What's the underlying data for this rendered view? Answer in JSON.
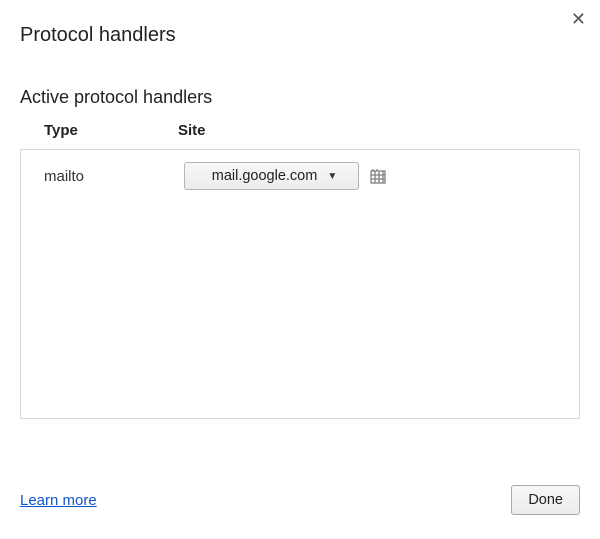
{
  "dialog": {
    "title": "Protocol handlers",
    "section_title": "Active protocol handlers"
  },
  "columns": {
    "type": "Type",
    "site": "Site"
  },
  "handlers": [
    {
      "type": "mailto",
      "site": "mail.google.com"
    }
  ],
  "footer": {
    "learn_more": "Learn more",
    "done": "Done"
  }
}
